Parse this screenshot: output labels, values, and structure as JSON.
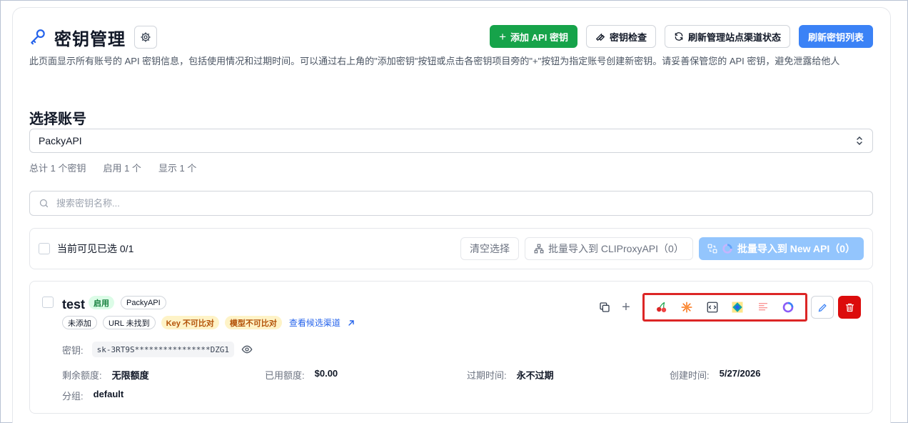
{
  "header": {
    "title": "密钥管理",
    "description": "此页面显示所有账号的 API 密钥信息，包括使用情况和过期时间。可以通过右上角的\"添加密钥\"按钮或点击各密钥项目旁的\"+\"按钮为指定账号创建新密钥。请妥善保管您的 API 密钥，避免泄露给他人"
  },
  "toolbar": {
    "add_label": "添加 API 密钥",
    "check_label": "密钥检查",
    "refresh_status_label": "刷新管理站点渠道状态",
    "refresh_list_label": "刷新密钥列表"
  },
  "account": {
    "section_title": "选择账号",
    "selected": "PackyAPI"
  },
  "stats": {
    "total": "总计 1 个密钥",
    "enabled": "启用 1 个",
    "shown": "显示 1 个"
  },
  "search": {
    "placeholder": "搜索密钥名称..."
  },
  "bulk": {
    "selected_label": "当前可见已选 0/1",
    "clear_label": "清空选择",
    "import_cli_label": "批量导入到 CLIProxyAPI（0）",
    "import_newapi_label": "批量导入到 New API（0）"
  },
  "key": {
    "name": "test",
    "status": "启用",
    "account": "PackyAPI",
    "badges": [
      "未添加",
      "URL 未找到",
      "Key 不可比对",
      "模型不可比对"
    ],
    "candidates_link": "查看候选渠道",
    "key_label": "密钥:",
    "key_value": "sk-3RT9S****************DZG1",
    "remaining_label": "剩余额度:",
    "remaining_value": "无限额度",
    "used_label": "已用额度:",
    "used_value": "$0.00",
    "expire_label": "过期时间:",
    "expire_value": "永不过期",
    "created_label": "创建时间:",
    "created_value": "5/27/2026",
    "group_label": "分组:",
    "group_value": "default",
    "platforms": [
      "cherry-studio-icon",
      "sparkle-icon",
      "code-box-icon",
      "gem-icon",
      "lobe-chat-icon",
      "new-api-ring-icon"
    ]
  },
  "colors": {
    "accent": "#3b82f6",
    "success": "#16a34a",
    "danger": "#dc0c0c",
    "highlight": "#dc2626"
  }
}
